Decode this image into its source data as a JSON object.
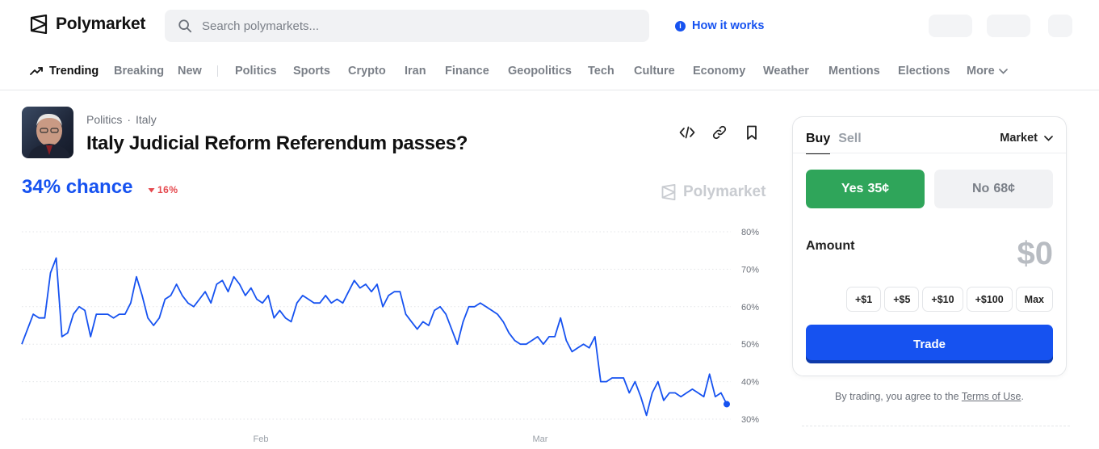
{
  "brand": {
    "name": "Polymarket"
  },
  "search": {
    "placeholder": "Search polymarkets..."
  },
  "header": {
    "how_it_works": "How it works"
  },
  "nav": {
    "trending": "Trending",
    "items": [
      "Breaking",
      "New",
      "Politics",
      "Sports",
      "Crypto",
      "Iran",
      "Finance",
      "Geopolitics",
      "Tech",
      "Culture",
      "Economy",
      "Weather",
      "Mentions",
      "Elections"
    ],
    "more": "More"
  },
  "event": {
    "category": "Politics",
    "subcategory": "Italy",
    "title": "Italy Judicial Reform Referendum passes?",
    "chance": "34% chance",
    "delta": "16%",
    "watermark": "Polymarket"
  },
  "trade": {
    "tab_buy": "Buy",
    "tab_sell": "Sell",
    "order_type": "Market",
    "yes_label": "Yes",
    "yes_price": "35¢",
    "no_label": "No",
    "no_price": "68¢",
    "amount_label": "Amount",
    "amount_value": "$0",
    "chips": [
      "+$1",
      "+$5",
      "+$10",
      "+$100",
      "Max"
    ],
    "trade_button": "Trade",
    "terms_prefix": "By trading, you agree to the",
    "terms_link": "Terms of Use",
    "terms_suffix": "."
  },
  "colors": {
    "accent": "#1652f0",
    "yes": "#2fa55a",
    "down": "#e5484d"
  },
  "chart_data": {
    "type": "line",
    "series": [
      {
        "values": [
          50,
          54,
          58,
          57,
          57,
          69,
          73,
          52,
          53,
          58,
          60,
          59,
          52,
          58,
          58,
          58,
          57,
          58,
          58,
          61,
          68,
          63,
          57,
          55,
          57,
          62,
          63,
          66,
          63,
          61,
          60,
          62,
          64,
          61,
          66,
          67,
          64,
          68,
          66,
          63,
          65,
          62,
          61,
          63,
          57,
          59,
          57,
          56,
          61,
          63,
          62,
          61,
          61,
          63,
          61,
          62,
          61,
          64,
          67,
          65,
          66,
          64,
          66,
          60,
          63,
          64,
          64,
          58,
          56,
          54,
          56,
          55,
          59,
          60,
          58,
          54,
          50,
          56,
          60,
          60,
          61,
          60,
          59,
          58,
          56,
          53,
          51,
          50,
          50,
          51,
          52,
          50,
          52,
          52,
          57,
          51,
          48,
          49,
          50,
          49,
          52,
          40,
          40,
          41,
          41,
          41,
          37,
          40,
          36,
          31,
          37,
          40,
          35,
          37,
          37,
          36,
          37,
          38,
          37,
          36,
          42,
          36,
          37,
          34
        ]
      }
    ],
    "x_ticks": [
      "Feb",
      "Mar"
    ],
    "y_ticks": [
      "80%",
      "70%",
      "60%",
      "50%",
      "40%",
      "30%"
    ],
    "ylim": [
      30,
      80
    ],
    "grid": true,
    "last_value": 34
  }
}
